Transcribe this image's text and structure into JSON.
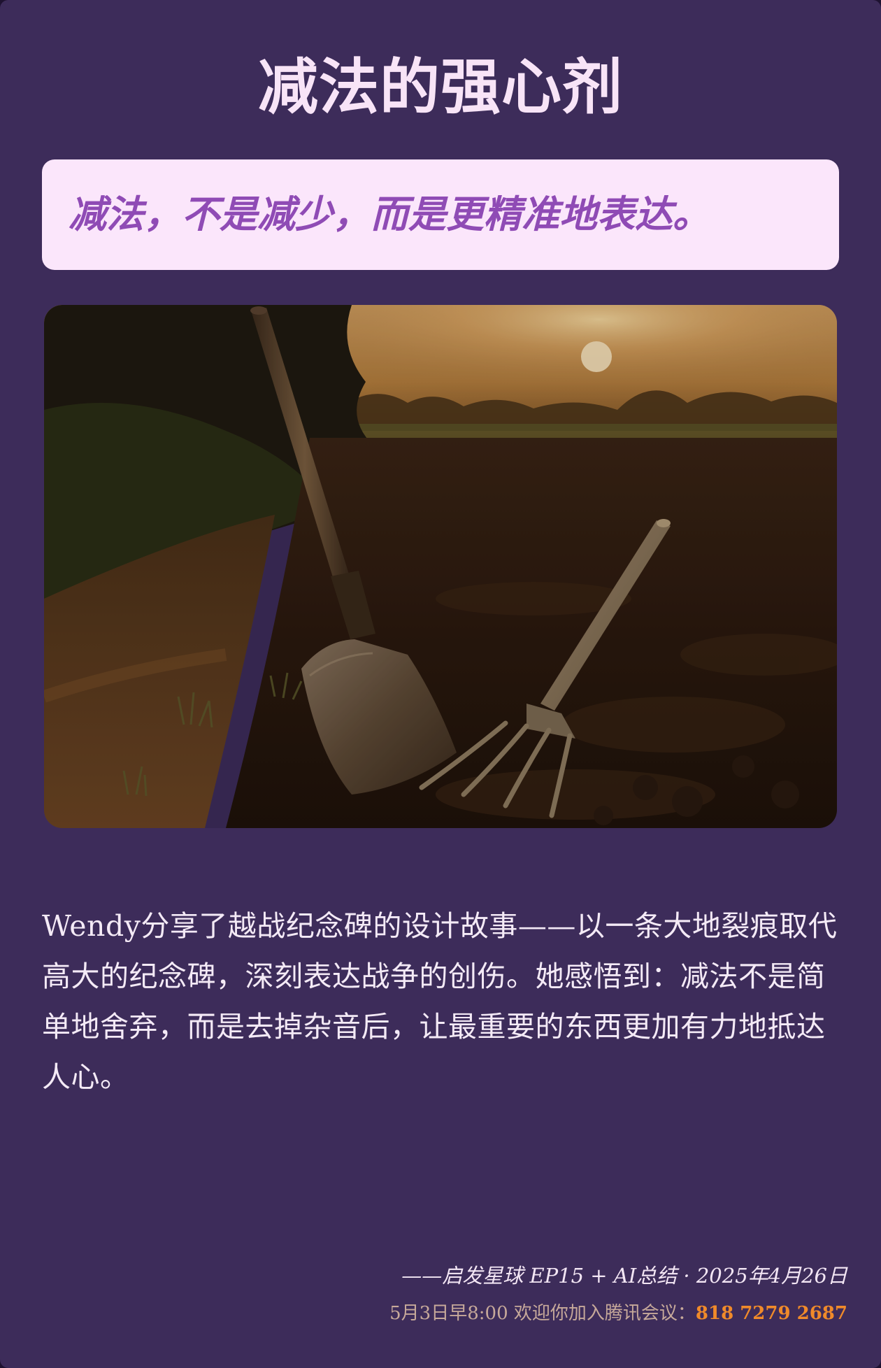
{
  "header": {
    "title": "减法的强心剂"
  },
  "quote": {
    "text": "减法，不是减少，而是更精准地表达。"
  },
  "image": {
    "subject": "shovel-and-pitchfork-in-field-at-sunset"
  },
  "content": {
    "paragraph": "Wendy分享了越战纪念碑的设计故事——以一条大地裂痕取代高大的纪念碑，深刻表达战争的创伤。她感悟到：减法不是简单地舍弃，而是去掉杂音后，让最重要的东西更加有力地抵达人心。"
  },
  "footer": {
    "credit": "——启发星球 EP15 + AI总结 · 2025年4月26日",
    "invite_label": "5月3日早8:00 欢迎你加入腾讯会议：",
    "meeting_id": "818 7279 2687"
  },
  "colors": {
    "background": "#3d2c5a",
    "title": "#f8e4f7",
    "quote_box": "#fbe6fb",
    "quote_text": "#8f4bb5",
    "meeting_id": "#f08a2a"
  }
}
